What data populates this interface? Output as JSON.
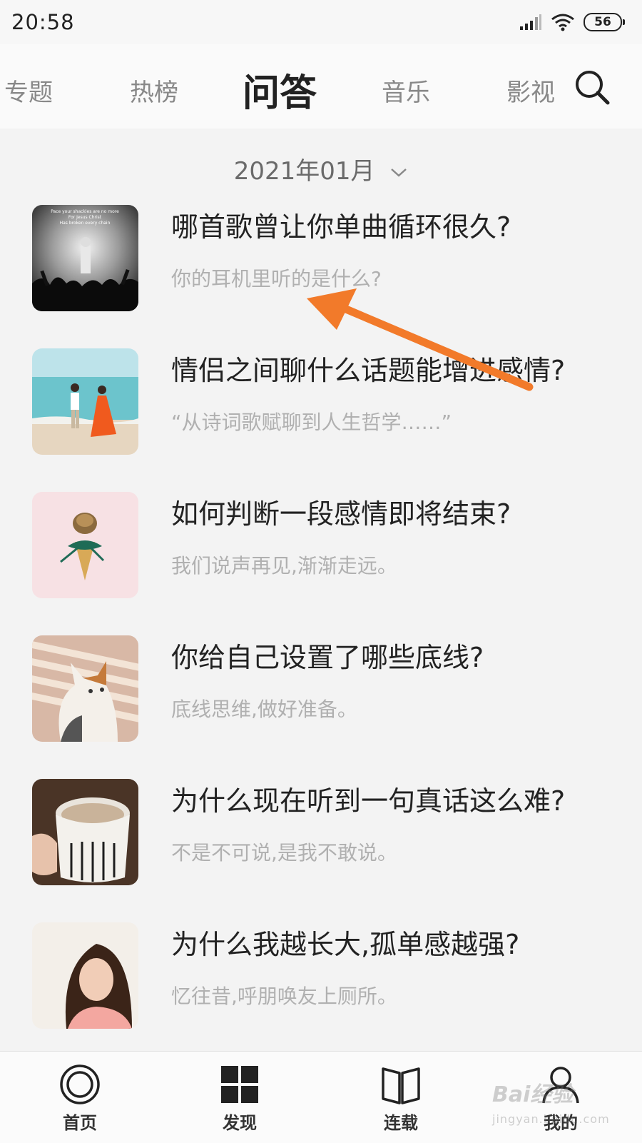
{
  "status": {
    "time": "20:58",
    "battery": "56"
  },
  "nav": {
    "tabs": [
      {
        "label": "专题",
        "active": false
      },
      {
        "label": "热榜",
        "active": false
      },
      {
        "label": "问答",
        "active": true
      },
      {
        "label": "音乐",
        "active": false
      },
      {
        "label": "影视",
        "active": false
      }
    ],
    "search_icon": "search-icon"
  },
  "date_picker": {
    "label": "2021年01月"
  },
  "questions": [
    {
      "title": "哪首歌曾让你单曲循环很久?",
      "subtitle": "你的耳机里听的是什么?",
      "thumb_icon": "concert-photo",
      "thumb_text": [
        "Pace your shackles are no more",
        "For Jesus Christ",
        "Has broken every chain"
      ]
    },
    {
      "title": "情侣之间聊什么话题能增进感情?",
      "subtitle": "“从诗词歌赋聊到人生哲学……”",
      "thumb_icon": "beach-couple-photo"
    },
    {
      "title": "如何判断一段感情即将结束?",
      "subtitle": "我们说声再见,渐渐走远。",
      "thumb_icon": "pinecone-cone-photo"
    },
    {
      "title": "你给自己设置了哪些底线?",
      "subtitle": "底线思维,做好准备。",
      "thumb_icon": "cat-photo"
    },
    {
      "title": "为什么现在听到一句真话这么难?",
      "subtitle": "不是不可说,是我不敢说。",
      "thumb_icon": "coffee-mug-photo"
    },
    {
      "title": "为什么我越长大,孤单感越强?",
      "subtitle": "忆往昔,呼朋唤友上厕所。",
      "thumb_icon": "girl-portrait-photo"
    }
  ],
  "bottom_nav": [
    {
      "label": "首页",
      "icon": "home-icon"
    },
    {
      "label": "发现",
      "icon": "grid-icon"
    },
    {
      "label": "连载",
      "icon": "book-icon"
    },
    {
      "label": "我的",
      "icon": "profile-icon"
    }
  ],
  "watermark": {
    "brand": "Bai经验",
    "url": "jingyan.baidu.com"
  },
  "colors": {
    "accent_arrow": "#f27a2a",
    "text_primary": "#222222",
    "text_secondary": "#b0b0b0"
  }
}
